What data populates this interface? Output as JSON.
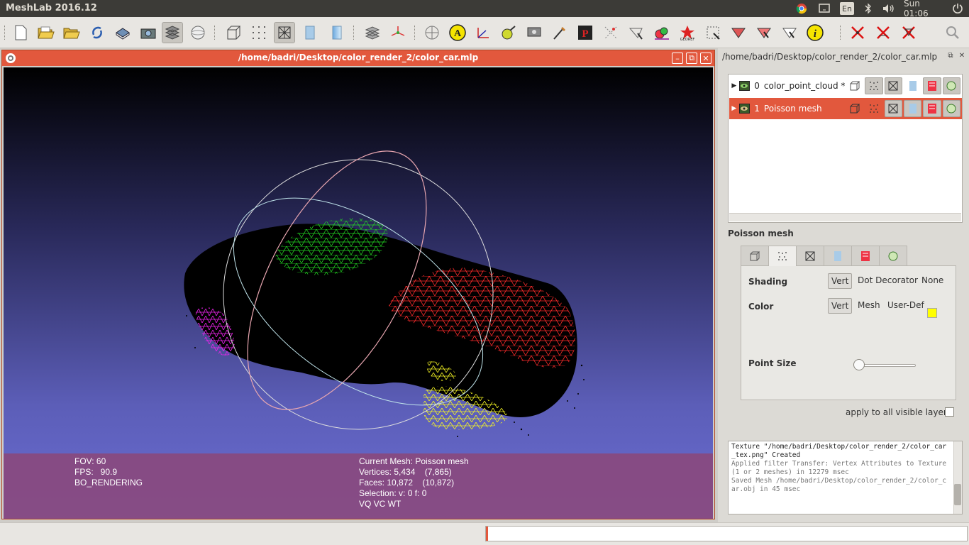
{
  "app": {
    "title": "MeshLab 2016.12"
  },
  "system": {
    "language": "En",
    "clock": "Sun 01:06"
  },
  "document": {
    "path": "/home/badri/Desktop/color_render_2/color_car.mlp"
  },
  "viewport": {
    "info_left": [
      "FOV: 60",
      "FPS:   90.9",
      "BO_RENDERING"
    ],
    "info_right": [
      "Current Mesh: Poisson mesh",
      "Vertices: 5,434    (7,865)",
      "Faces: 10,872    (10,872)",
      "Selection: v: 0 f: 0",
      "VQ VC WT"
    ]
  },
  "layers": [
    {
      "index": "0",
      "name": "color_point_cloud *",
      "selected": false
    },
    {
      "index": "1",
      "name": "Poisson mesh",
      "selected": true
    }
  ],
  "properties": {
    "heading": "Poisson mesh",
    "shading": {
      "label": "Shading",
      "options": [
        "Vert",
        "Dot Decorator",
        "None"
      ],
      "selected": "Vert"
    },
    "color": {
      "label": "Color",
      "options": [
        "Vert",
        "Mesh",
        "User-Def"
      ],
      "selected": "Vert",
      "user_def_color": "#ffff00"
    },
    "point_size": {
      "label": "Point Size",
      "value": 0
    },
    "apply_all": "apply to all visible layers"
  },
  "log": [
    "Texture \"/home/badri/Desktop/color_render_2/color_car_tex.png\" Created",
    "Applied filter Transfer: Vertex Attributes to Texture (1 or 2 meshes) in 12279 msec",
    "Saved Mesh /home/badri/Desktop/color_render_2/color_car.obj in 45 msec"
  ],
  "colors": {
    "accent": "#e2583d",
    "panel": "#3c3b37",
    "mesh_green": "#22cc22",
    "mesh_red": "#ee2222",
    "mesh_magenta": "#dd22dd",
    "mesh_yellow": "#eeee22"
  },
  "icons": {
    "toolbar": [
      "new-project-icon",
      "open-project-icon",
      "import-mesh-icon",
      "reload-icon",
      "export-mesh-icon",
      "snapshot-icon",
      "layers-icon",
      "rotate-icon",
      "bbox-icon",
      "points-icon",
      "wireframe-icon",
      "flat-icon",
      "smooth-icon",
      "texture-icon",
      "axis-icon",
      "trackball-icon",
      "annotate-icon",
      "measure-icon",
      "paint-icon",
      "pickpoints-icon",
      "georef-icon",
      "select-icon",
      "info-icon",
      "close-icon",
      "search-icon"
    ]
  }
}
